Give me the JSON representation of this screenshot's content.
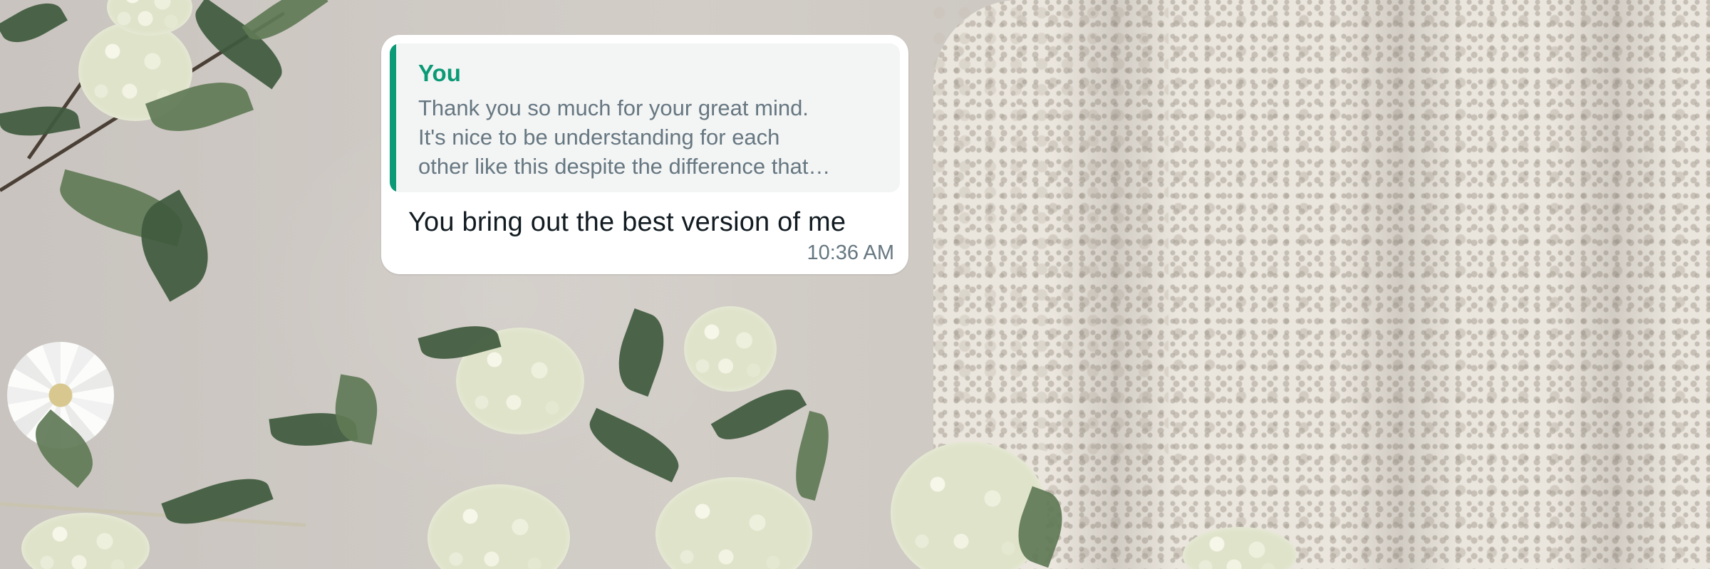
{
  "chat": {
    "message": {
      "quoted": {
        "author": "You",
        "text": "Thank you so much for your great mind.\nIt's nice to be understanding for each\nother like this despite the difference that…",
        "accent_color": "#0b9a76"
      },
      "text": "You bring out the best version of me",
      "time": "10:36 AM",
      "bubble_color": "#ffffff"
    }
  },
  "wallpaper": {
    "description_icon": "flowers-and-lace-wallpaper"
  }
}
